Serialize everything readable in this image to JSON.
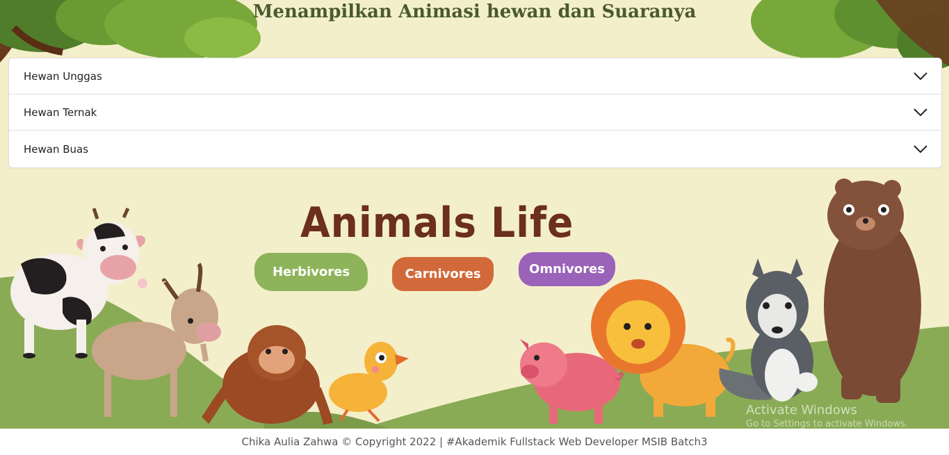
{
  "header": {
    "title": "Menampilkan Animasi hewan dan Suaranya"
  },
  "accordion": {
    "items": [
      {
        "label": "Hewan Unggas"
      },
      {
        "label": "Hewan Ternak"
      },
      {
        "label": "Hewan Buas"
      }
    ]
  },
  "banner": {
    "headline": "Animals Life",
    "categories": [
      {
        "label": "Herbivores",
        "color": "#8db45a"
      },
      {
        "label": "Carnivores",
        "color": "#d2693a"
      },
      {
        "label": "Omnivores",
        "color": "#9a62b8"
      }
    ],
    "illustrations": [
      "cow",
      "goat",
      "orangutan",
      "duckling",
      "pig",
      "lion",
      "wolf",
      "bear",
      "tree-foliage"
    ]
  },
  "watermark": {
    "title": "Activate Windows",
    "subtitle": "Go to Settings to activate Windows."
  },
  "footer": {
    "text": "Chika Aulia Zahwa © Copyright 2022 | #Akademik Fullstack Web Developer MSIB Batch3"
  },
  "colors": {
    "background": "#f4efcb",
    "title": "#4a5a2d",
    "headline": "#6b2f1c",
    "grass": "#8aab55"
  }
}
